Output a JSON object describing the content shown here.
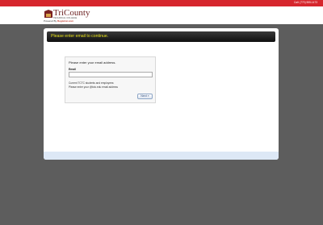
{
  "topbar": {
    "phone": "Call: (770) 555-1473"
  },
  "logo": {
    "name": "TriCounty",
    "subtitle": "TECHNICAL COLLEGE",
    "powered_prefix": "Powered By",
    "powered_brand": "Registrar.com"
  },
  "banner": {
    "text": "Please enter email to continue."
  },
  "form": {
    "prompt": "Please enter your email address.",
    "email_label": "Email",
    "email_value": "",
    "note1": "Current TCTC students and employees:",
    "note2": "Please enter your @tctc.edu email address",
    "next_label": "Next »"
  },
  "colors": {
    "topbar": "#d6262d",
    "banner_text": "#e8e21c",
    "page_bg": "#5d5d5d"
  }
}
